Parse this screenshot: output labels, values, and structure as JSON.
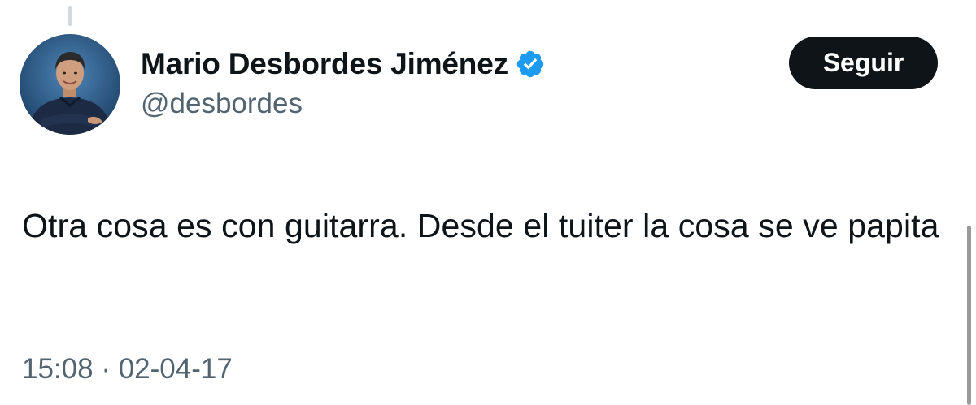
{
  "user": {
    "display_name": "Mario Desbordes Jiménez",
    "handle": "@desbordes",
    "verified_icon": "verified-badge-icon",
    "verified_color": "#1d9bf0"
  },
  "follow_button": {
    "label": "Seguir"
  },
  "tweet": {
    "text": "Otra cosa es con guitarra. Desde el tuiter la cosa se ve papita",
    "time": "15:08",
    "separator": "·",
    "date": "02-04-17"
  },
  "colors": {
    "text_primary": "#0f1419",
    "text_secondary": "#536471",
    "button_bg": "#0f1419",
    "button_text": "#ffffff"
  }
}
